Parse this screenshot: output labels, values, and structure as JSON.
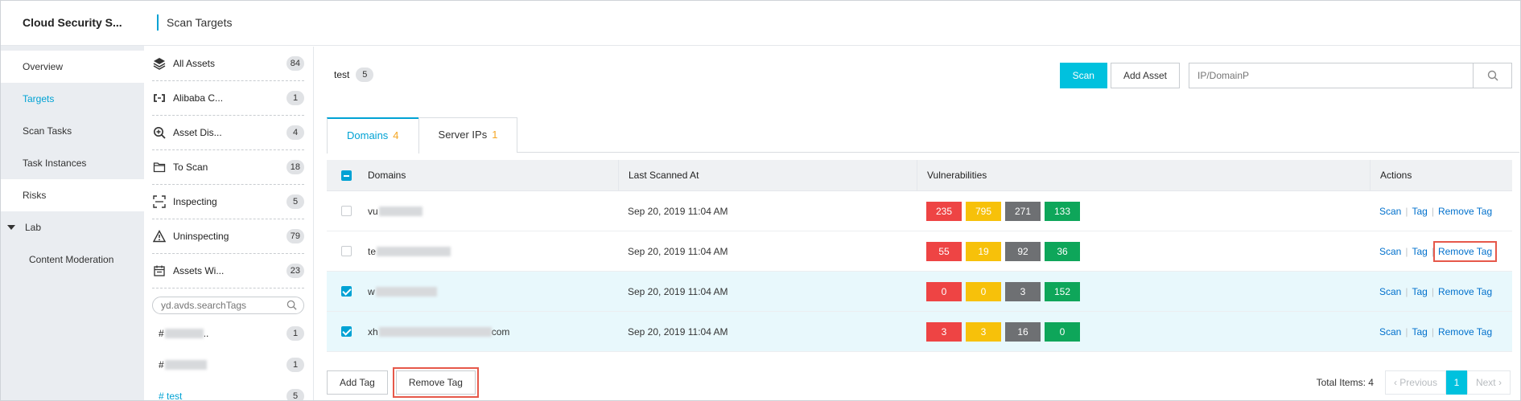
{
  "nav": {
    "title": "Cloud Security S...",
    "items": [
      {
        "label": "Overview"
      },
      {
        "label": "Targets"
      },
      {
        "label": "Scan Tasks"
      },
      {
        "label": "Task Instances"
      },
      {
        "label": "Risks"
      },
      {
        "label": "Lab"
      },
      {
        "label": "Content Moderation"
      }
    ]
  },
  "header": {
    "title": "Scan Targets"
  },
  "groups": {
    "items": [
      {
        "label": "All Assets",
        "count": "84",
        "icon": "layers-icon"
      },
      {
        "label": "Alibaba C...",
        "count": "1",
        "icon": "cloud-bracket-icon"
      },
      {
        "label": "Asset Dis...",
        "count": "4",
        "icon": "zoom-in-icon"
      },
      {
        "label": "To Scan",
        "count": "18",
        "icon": "folder-icon"
      },
      {
        "label": "Inspecting",
        "count": "5",
        "icon": "scan-frame-icon"
      },
      {
        "label": "Uninspecting",
        "count": "79",
        "icon": "warning-icon"
      },
      {
        "label": "Assets Wi...",
        "count": "23",
        "icon": "calendar-icon"
      }
    ],
    "tag_search_placeholder": "yd.avds.searchTags",
    "tags": [
      {
        "prefix": "#",
        "suffix": "..",
        "count": "1"
      },
      {
        "prefix": "#",
        "suffix": "",
        "count": "1"
      },
      {
        "label": "# test",
        "count": "5"
      }
    ]
  },
  "main": {
    "selected_group": "test",
    "selected_count": "5",
    "scan_label": "Scan",
    "add_asset_label": "Add Asset",
    "search_placeholder": "IP/DomainP",
    "tabs": [
      {
        "label": "Domains",
        "count": "4"
      },
      {
        "label": "Server IPs",
        "count": "1"
      }
    ],
    "table": {
      "headers": {
        "domains": "Domains",
        "last_scanned": "Last Scanned At",
        "vulnerabilities": "Vulnerabilities",
        "actions": "Actions"
      },
      "rows": [
        {
          "domain_prefix": "vu",
          "domain_suffix": "",
          "time": "Sep 20, 2019 11:04 AM",
          "v": [
            "235",
            "795",
            "271",
            "133"
          ],
          "checked": false
        },
        {
          "domain_prefix": "te",
          "domain_suffix": "",
          "time": "Sep 20, 2019 11:04 AM",
          "v": [
            "55",
            "19",
            "92",
            "36"
          ],
          "checked": false
        },
        {
          "domain_prefix": "w",
          "domain_suffix": "",
          "time": "Sep 20, 2019 11:04 AM",
          "v": [
            "0",
            "0",
            "3",
            "152"
          ],
          "checked": true
        },
        {
          "domain_prefix": "xh",
          "domain_suffix": "com",
          "time": "Sep 20, 2019 11:04 AM",
          "v": [
            "3",
            "3",
            "16",
            "0"
          ],
          "checked": true
        }
      ],
      "actions": {
        "scan": "Scan",
        "tag": "Tag",
        "remove_tag": "Remove Tag"
      }
    },
    "footer": {
      "add_tag_label": "Add Tag",
      "remove_tag_label": "Remove Tag",
      "total_label": "Total Items: 4",
      "prev_label": "Previous",
      "page": "1",
      "next_label": "Next"
    }
  },
  "colors": {
    "accent": "#00a2d4",
    "primary_button": "#00c1de",
    "critical": "#ee4444",
    "high": "#f7c10a",
    "medium": "#6e7073",
    "low": "#0ea65a",
    "highlight_box": "#e6584a"
  }
}
